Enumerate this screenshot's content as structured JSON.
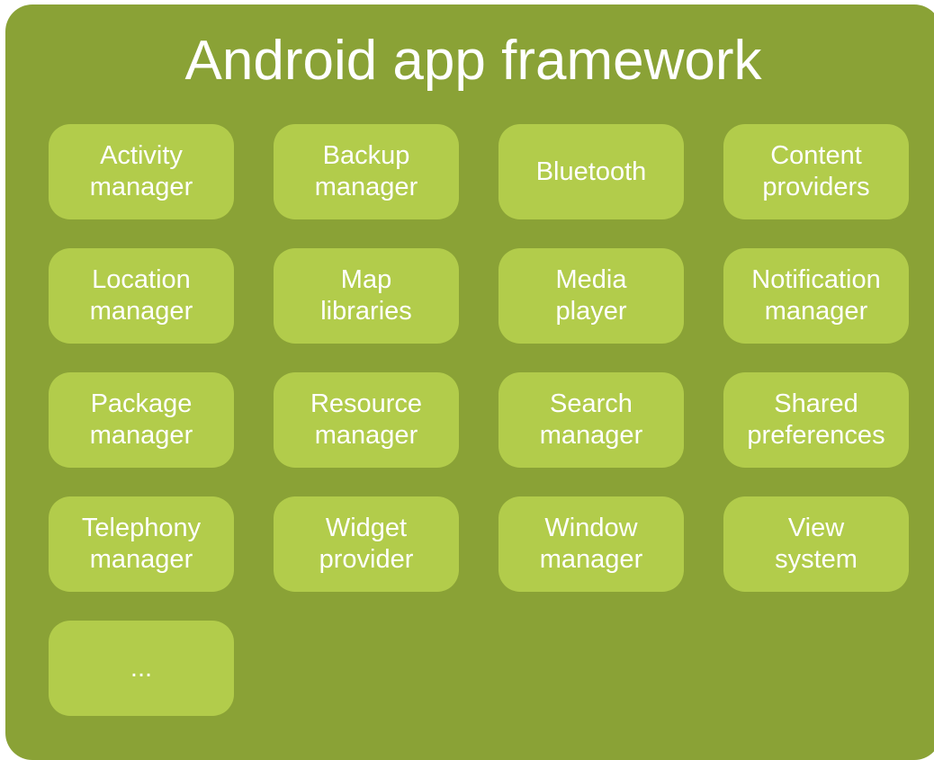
{
  "title": "Android app framework",
  "components": [
    "Activity\nmanager",
    "Backup\nmanager",
    "Bluetooth",
    "Content\nproviders",
    "Location\nmanager",
    "Map\nlibraries",
    "Media\nplayer",
    "Notification\nmanager",
    "Package\nmanager",
    "Resource\nmanager",
    "Search\nmanager",
    "Shared\npreferences",
    "Telephony\nmanager",
    "Widget\nprovider",
    "Window\nmanager",
    "View\nsystem",
    "..."
  ],
  "colors": {
    "container": "#8aa236",
    "box": "#b2cc4b",
    "text": "#ffffff"
  }
}
